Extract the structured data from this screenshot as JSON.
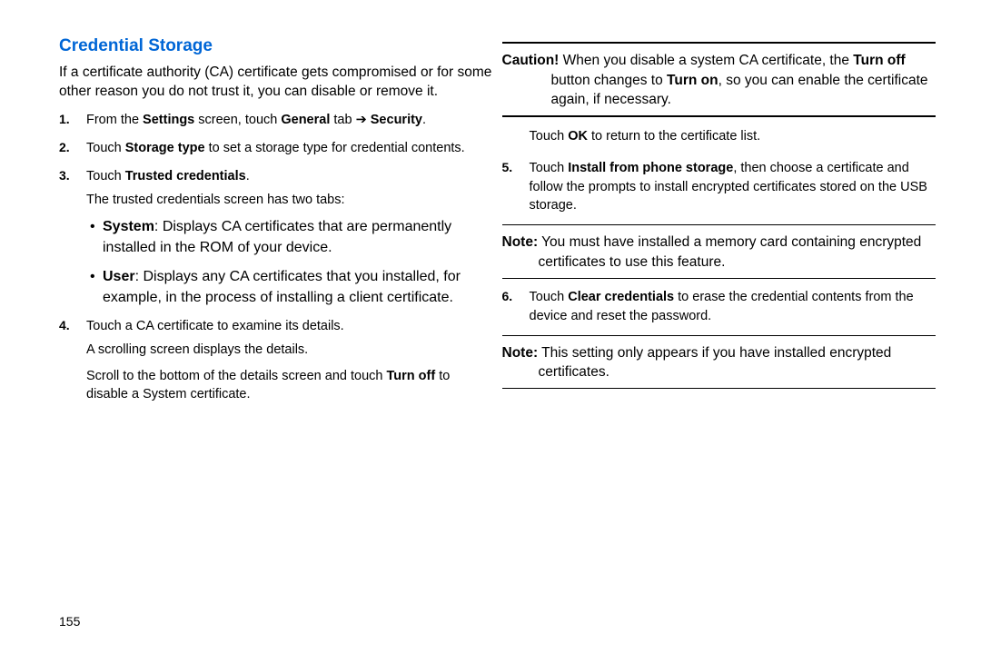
{
  "heading": "Credential Storage",
  "intro": "If a certificate authority (CA) certificate gets compromised or for some other reason you do not trust it, you can disable or remove it.",
  "step1_pre": "From the ",
  "step1_b1": "Settings",
  "step1_mid": " screen, touch ",
  "step1_b2": "General",
  "step1_post": " tab ➔ ",
  "step1_b3": "Security",
  "step1_end": ".",
  "step2_pre": "Touch ",
  "step2_b1": "Storage type",
  "step2_post": " to set a storage type for credential contents.",
  "step3_pre": "Touch ",
  "step3_b1": "Trusted credentials",
  "step3_post": ".",
  "step3_line2": "The trusted credentials screen has two tabs:",
  "bullet1_b": "System",
  "bullet1_t": ": Displays CA certificates that are permanently installed in the ROM of your device.",
  "bullet2_b": "User",
  "bullet2_t": ": Displays any CA certificates that you installed, for example, in the process of installing a client certificate.",
  "step4_a": "Touch a CA certificate to examine its details.",
  "step4_b": "A scrolling screen displays the details.",
  "step4_c_pre": "Scroll to the bottom of the details screen and touch ",
  "step4_c_b": "Turn off",
  "step4_c_post": " to disable a System certificate.",
  "caution_label": "Caution!",
  "caution_pre": " When you disable a system CA certificate, the ",
  "caution_b1": "Turn off",
  "caution_mid": " button changes to ",
  "caution_b2": "Turn on",
  "caution_post": ", so you can enable the certificate again, if necessary.",
  "ok_pre": "Touch ",
  "ok_b": "OK",
  "ok_post": " to return to the certificate list.",
  "step5_pre": "Touch ",
  "step5_b": "Install from phone storage",
  "step5_post": ", then choose a certificate and follow the prompts to install encrypted certificates stored on the USB storage.",
  "note1_label": "Note:",
  "note1_text": " You must have installed a memory card containing encrypted certificates to use this feature.",
  "step6_pre": "Touch ",
  "step6_b": "Clear credentials",
  "step6_post": " to erase the credential contents from the device and reset the password.",
  "note2_label": "Note:",
  "note2_text": " This setting only appears if you have installed encrypted certificates.",
  "page_number": "155"
}
